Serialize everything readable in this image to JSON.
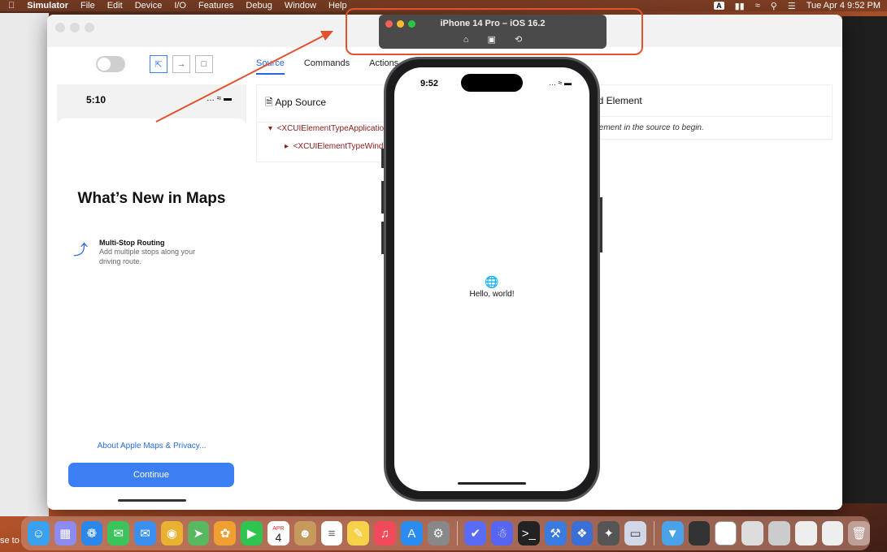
{
  "menubar": {
    "apple": "",
    "app": "Simulator",
    "items": [
      "File",
      "Edit",
      "Device",
      "I/O",
      "Features",
      "Debug",
      "Window",
      "Help"
    ],
    "input_source": "A",
    "clock": "Tue Apr 4  9:52 PM"
  },
  "appium": {
    "tabs": [
      "Source",
      "Commands",
      "Actions"
    ],
    "source_header": "App Source",
    "nodes": [
      "<XCUIElementTypeApplicatio",
      "<XCUIElementTypeWind"
    ],
    "selected_header": "ed Element",
    "selected_hint": "element in the source to begin."
  },
  "screenshot": {
    "time": "5:10",
    "heading": "What’s New in Maps",
    "feature_title": "Multi-Stop Routing",
    "feature_desc": "Add multiple stops along your driving route.",
    "about_link": "About Apple Maps & Privacy...",
    "continue_label": "Continue"
  },
  "simulator": {
    "title": "iPhone 14 Pro – iOS 16.2",
    "icons": [
      "home-icon",
      "screenshot-icon",
      "rotate-icon"
    ]
  },
  "phone": {
    "time": "9:52",
    "status": "... ",
    "hello": "Hello, world!"
  },
  "dock": {
    "calendar_month": "APR",
    "calendar_day": "4"
  },
  "left_edge_text": "se to",
  "colors": {
    "accent": "#2563eb",
    "highlight": "#e0532e",
    "button": "#3b7ff2"
  }
}
